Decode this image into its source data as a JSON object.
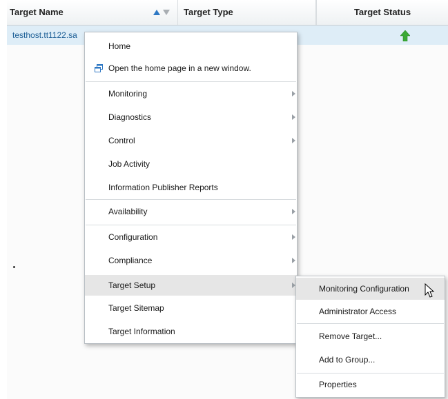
{
  "table": {
    "columns": {
      "name": "Target Name",
      "type": "Target Type",
      "status": "Target Status"
    },
    "rows": [
      {
        "name": "testhost.tt1122.sa",
        "status": "up"
      }
    ]
  },
  "context_menu": {
    "home": "Home",
    "open_new_window": "Open the home page in a new window.",
    "monitoring": "Monitoring",
    "diagnostics": "Diagnostics",
    "control": "Control",
    "job_activity": "Job Activity",
    "information_publisher_reports": "Information Publisher Reports",
    "availability": "Availability",
    "configuration": "Configuration",
    "compliance": "Compliance",
    "target_setup": "Target Setup",
    "target_sitemap": "Target Sitemap",
    "target_information": "Target Information"
  },
  "submenu": {
    "monitoring_configuration": "Monitoring Configuration",
    "administrator_access": "Administrator Access",
    "remove_target": "Remove Target...",
    "add_to_group": "Add to Group...",
    "properties": "Properties"
  },
  "colors": {
    "row_selected": "#deedf7",
    "status_up": "#3aa935",
    "sort_active": "#2e78c4",
    "menu_highlight": "#e6e6e6"
  },
  "icons": {
    "status": "status-up-arrow-icon",
    "new_window": "new-window-icon",
    "submenu": "submenu-arrow-icon",
    "cursor": "mouse-cursor-icon"
  }
}
